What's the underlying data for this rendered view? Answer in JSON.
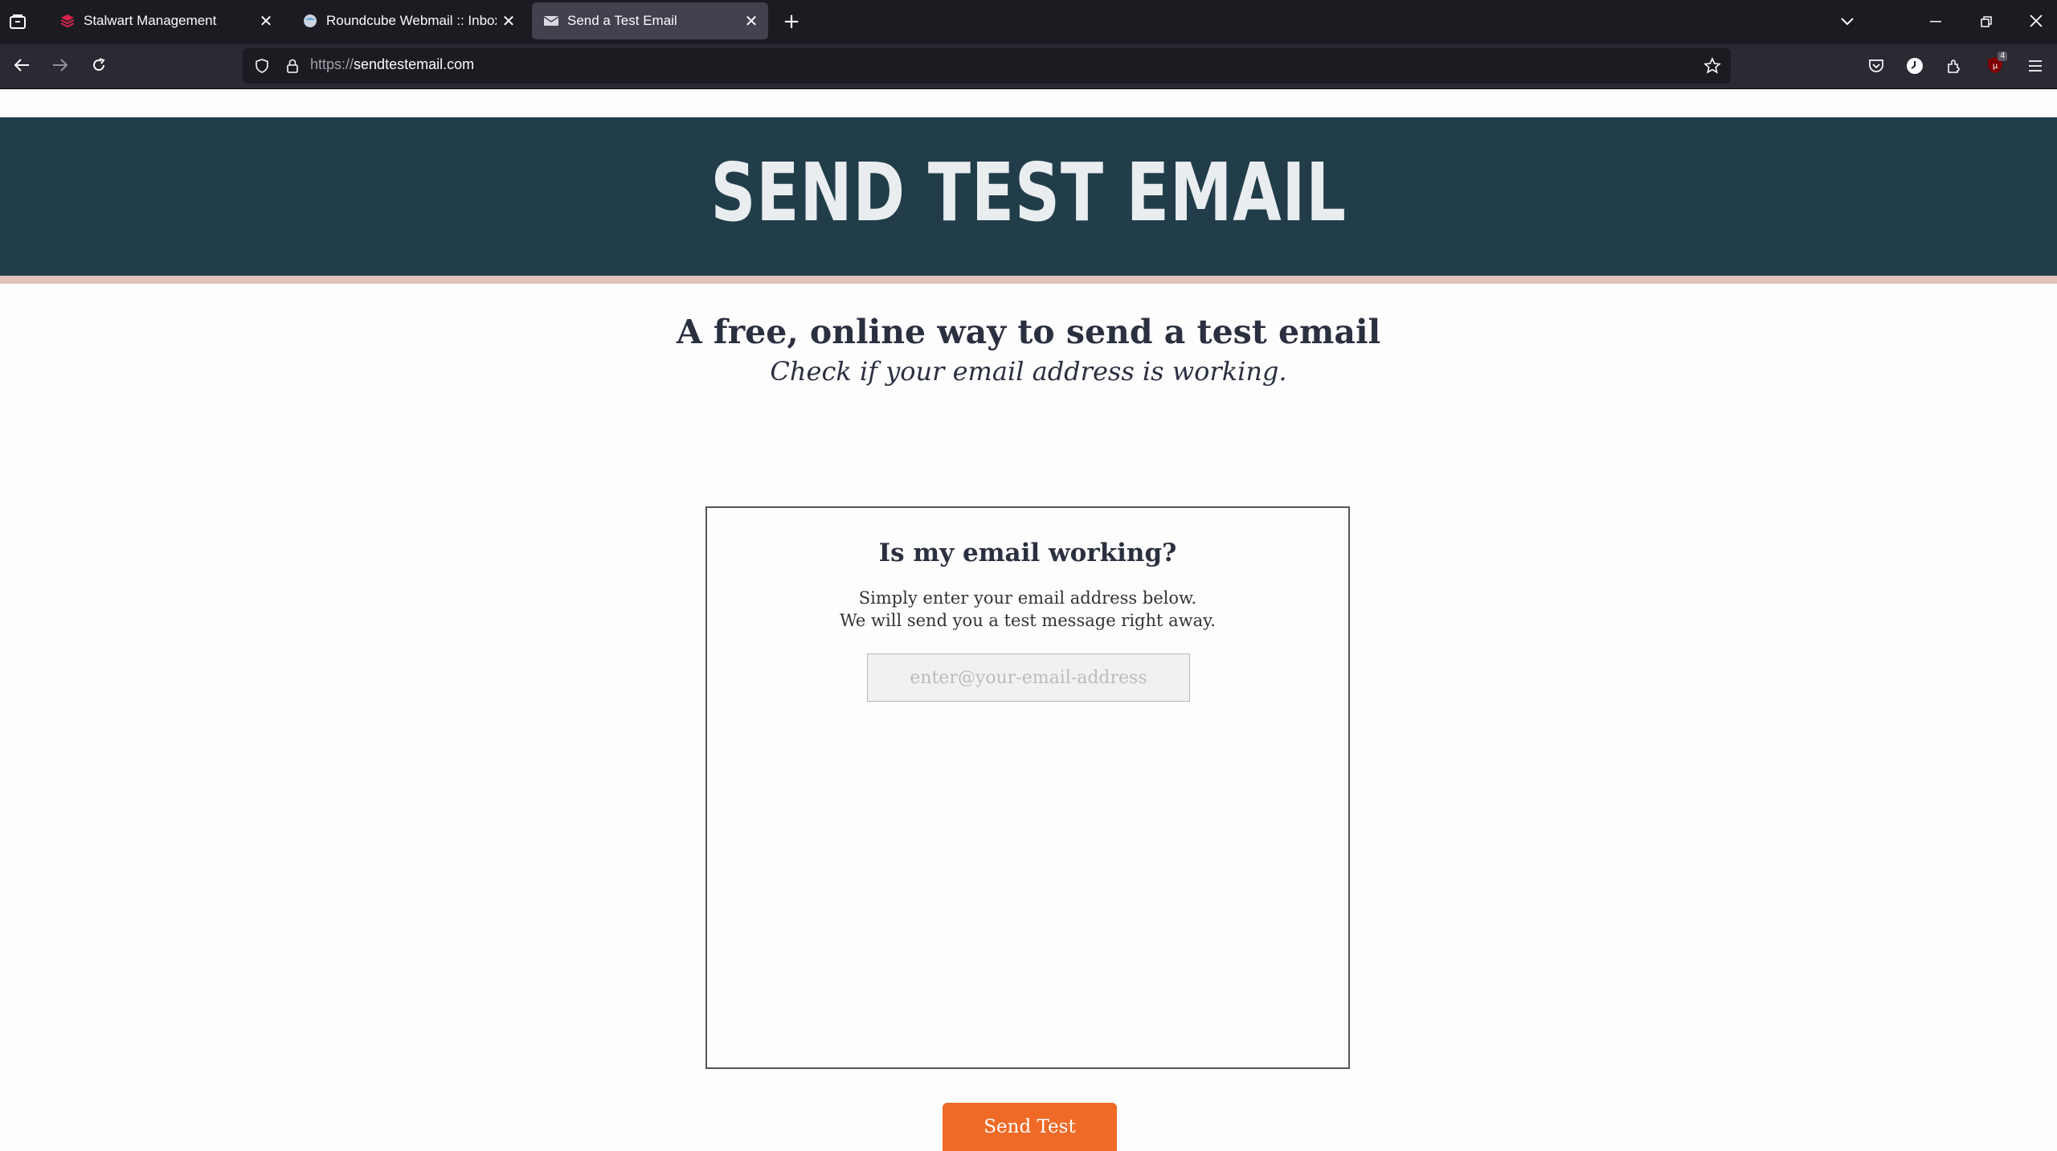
{
  "browser": {
    "tabs": [
      {
        "title": "Stalwart Management",
        "icon": "stalwart-logo-icon",
        "active": false
      },
      {
        "title": "Roundcube Webmail :: Inbox",
        "icon": "roundcube-logo-icon",
        "active": false
      },
      {
        "title": "Send a Test Email",
        "icon": "envelope-icon",
        "active": true
      }
    ],
    "url_scheme": "https://",
    "url_host": "sendtestemail.com",
    "extension_badge": "4"
  },
  "page": {
    "banner_title": "SEND TEST EMAIL",
    "headline": "A free, online way to send a test email",
    "subheadline": "Check if your email address is working.",
    "card": {
      "title": "Is my email working?",
      "desc_line1": "Simply enter your email address below.",
      "desc_line2": "We will send you a test message right away.",
      "email_placeholder": "enter@your-email-address",
      "email_value": "",
      "button_label": "Send Test"
    }
  },
  "colors": {
    "banner_bg": "#213d4a",
    "banner_accent": "#e3c3bb",
    "button_bg": "#ef6a27"
  }
}
